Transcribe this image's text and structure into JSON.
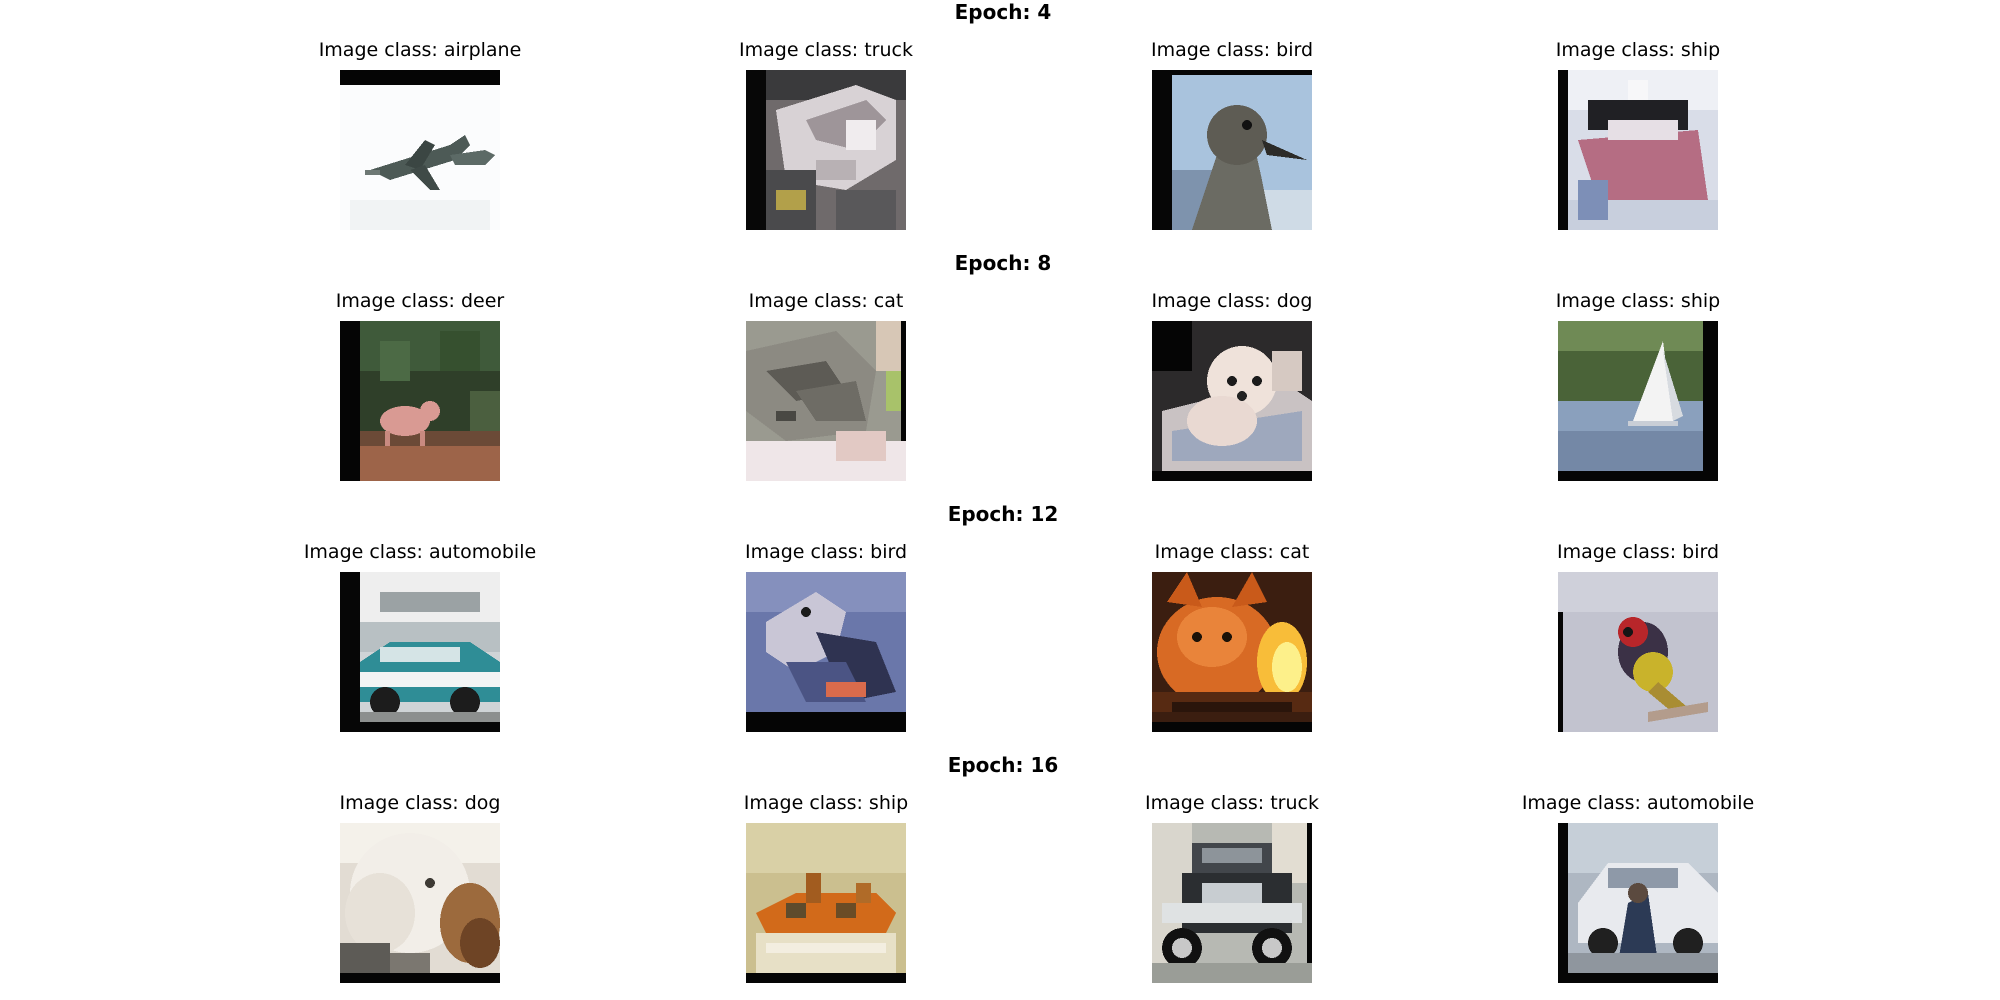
{
  "figure": {
    "epochs": [
      {
        "label": "Epoch: 4",
        "images": [
          {
            "title": "Image class: airplane",
            "scene": "airplane"
          },
          {
            "title": "Image class: truck",
            "scene": "truck"
          },
          {
            "title": "Image class: bird",
            "scene": "ostrich"
          },
          {
            "title": "Image class: ship",
            "scene": "ship-red"
          }
        ]
      },
      {
        "label": "Epoch: 8",
        "images": [
          {
            "title": "Image class: deer",
            "scene": "deer"
          },
          {
            "title": "Image class: cat",
            "scene": "cat-grey"
          },
          {
            "title": "Image class: dog",
            "scene": "dog-white"
          },
          {
            "title": "Image class: ship",
            "scene": "sailboat"
          }
        ]
      },
      {
        "label": "Epoch: 12",
        "images": [
          {
            "title": "Image class: automobile",
            "scene": "car-teal"
          },
          {
            "title": "Image class: bird",
            "scene": "bird-blue"
          },
          {
            "title": "Image class: cat",
            "scene": "cat-orange"
          },
          {
            "title": "Image class: bird",
            "scene": "bird-perched"
          }
        ]
      },
      {
        "label": "Epoch: 16",
        "images": [
          {
            "title": "Image class: dog",
            "scene": "dog-fluffy"
          },
          {
            "title": "Image class: ship",
            "scene": "ship-orange"
          },
          {
            "title": "Image class: truck",
            "scene": "truck-jeep"
          },
          {
            "title": "Image class: automobile",
            "scene": "car-white"
          }
        ]
      }
    ]
  }
}
